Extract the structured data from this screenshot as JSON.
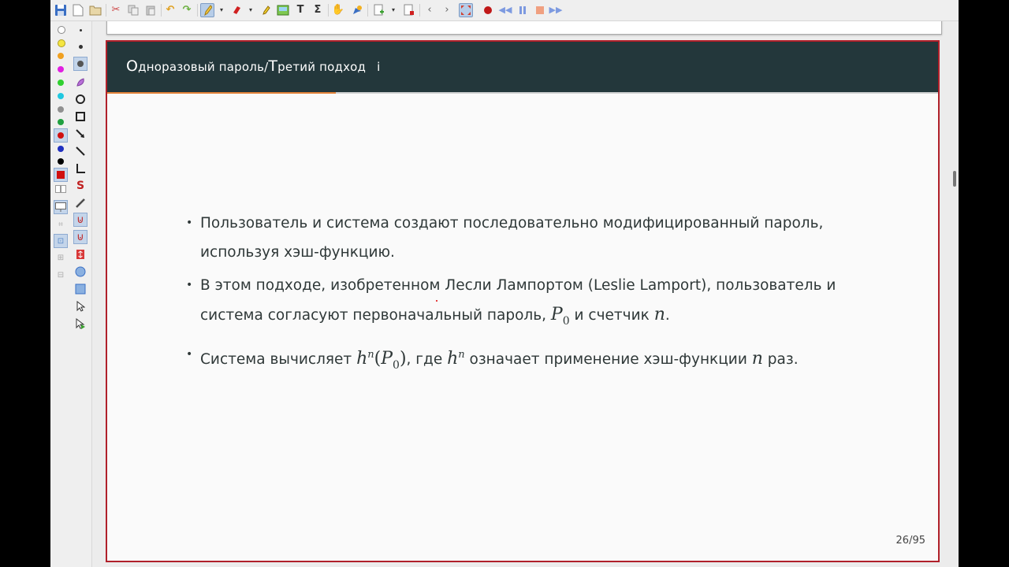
{
  "toolbar": {
    "icons": [
      "save-icon",
      "new-icon",
      "open-icon",
      "cut-icon",
      "copy-icon",
      "paste-icon",
      "undo-icon",
      "redo-icon",
      "pen-icon",
      "eraser-icon",
      "highlighter-icon",
      "image-icon",
      "text-icon",
      "math-icon",
      "hand-icon",
      "select-icon",
      "add-page-icon",
      "delete-page-icon",
      "prev-page-icon",
      "next-page-icon",
      "fullscreen-icon",
      "record-icon",
      "rewind-icon",
      "pause-icon",
      "stop-icon",
      "fast-forward-icon"
    ]
  },
  "palette": {
    "colors": [
      "#ffffff",
      "#f5e642",
      "#f0a020",
      "#e020e0",
      "#30d030",
      "#20c8e0",
      "#909090",
      "#20a040",
      "#d01010",
      "#2030c0",
      "#000000"
    ]
  },
  "slide": {
    "title_cap1": "О",
    "title_rest1": "дноразовый пароль/",
    "title_cap2": "Т",
    "title_rest2": "ретий подход",
    "title_suffix": "i",
    "bullet": "•",
    "item1": "Пользователь и система создают последовательно модифицированный пароль, используя хэш-функцию.",
    "item2_text": "В этом подходе, изобретенном Лесли Лампортом (Leslie Lamport), пользователь и система согласуют первоначальный пароль, ",
    "item2_mid": " и счетчик ",
    "item3_a": "Система вычисляет ",
    "item3_b": ", где ",
    "item3_c": " означает применение хэш-функции ",
    "item3_d": " раз.",
    "math_P": "P",
    "math_0": "0",
    "math_n": "n",
    "math_h": "h",
    "math_lp": "(",
    "math_rp": ")",
    "period": ".",
    "page_number": "26/95"
  }
}
